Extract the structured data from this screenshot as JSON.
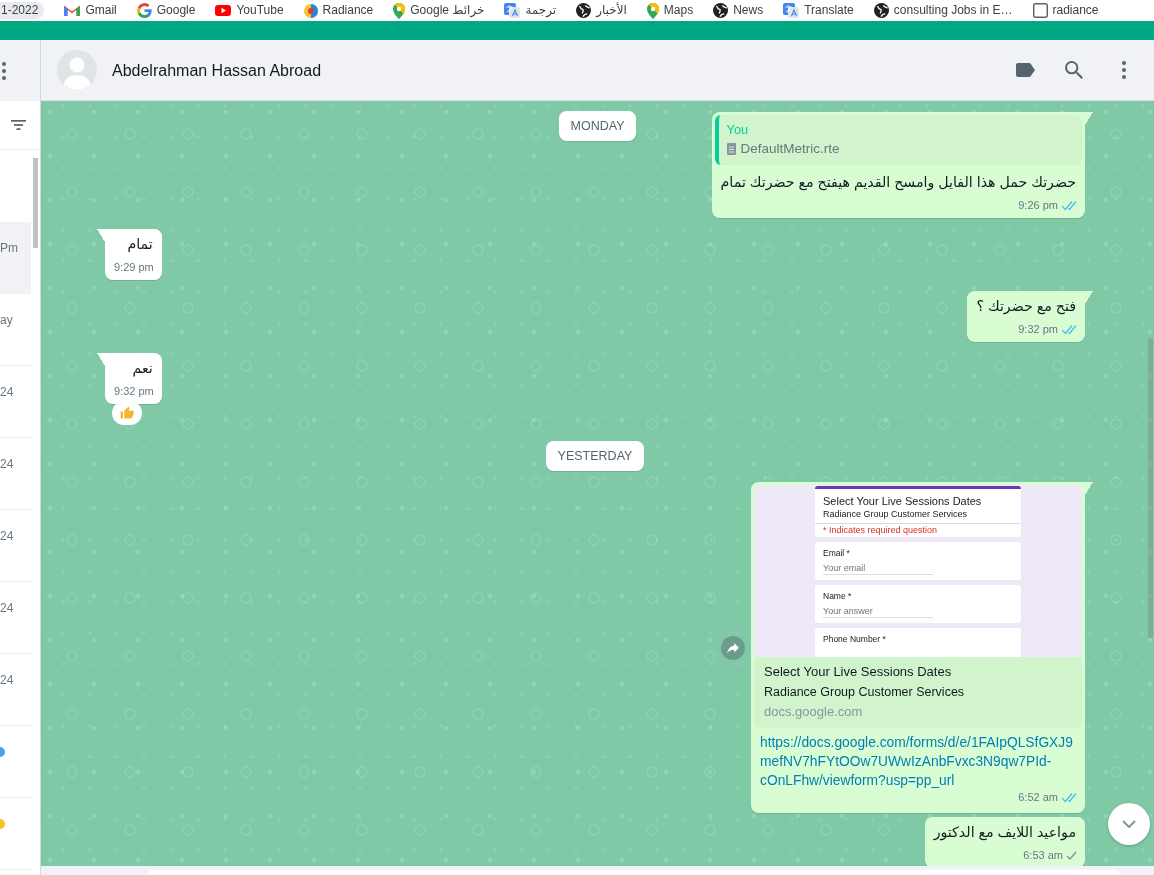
{
  "bookmarks_bar": {
    "items": [
      {
        "label": "1-2022",
        "kind": "chip"
      },
      {
        "label": "Gmail",
        "kind": "mail"
      },
      {
        "label": "Google",
        "kind": "google"
      },
      {
        "label": "YouTube",
        "kind": "video"
      },
      {
        "label": "Radiance",
        "kind": "logo"
      },
      {
        "label": "Google خرائط",
        "kind": "maps"
      },
      {
        "label": "ترجمة",
        "kind": "translate"
      },
      {
        "label": "الأخبار",
        "kind": "globe"
      },
      {
        "label": "Maps",
        "kind": "maps"
      },
      {
        "label": "News",
        "kind": "globe"
      },
      {
        "label": "Translate",
        "kind": "translate"
      },
      {
        "label": "consulting Jobs in E…",
        "kind": "globe"
      },
      {
        "label": "radiance",
        "kind": "page"
      }
    ]
  },
  "sidebar": {
    "rows": [
      {
        "kind": "time",
        "text": "Pm",
        "selected": true
      },
      {
        "kind": "time",
        "text": "ay",
        "selected": false
      },
      {
        "kind": "time",
        "text": "24",
        "selected": false
      },
      {
        "kind": "time",
        "text": "24",
        "selected": false
      },
      {
        "kind": "time",
        "text": "24",
        "selected": false
      },
      {
        "kind": "time",
        "text": "24",
        "selected": false
      },
      {
        "kind": "time",
        "text": "24",
        "selected": false
      },
      {
        "kind": "dot",
        "color": "#3aa8f0",
        "selected": false
      },
      {
        "kind": "dot",
        "color": "#f6c31c",
        "selected": false
      }
    ]
  },
  "chat": {
    "contact": {
      "name": "Abdelrahman Hassan Abroad"
    },
    "messages": [
      {
        "kind": "date",
        "text": "MONDAY",
        "pinned": true
      },
      {
        "kind": "outgoing",
        "tail": true,
        "forward": false,
        "quote": {
          "author": "You",
          "file": "DefaultMetric.rte"
        },
        "text": "حضرتك حمل هذا الفايل وامسح القديم هيفتح مع حضرتك تمام",
        "time": "9:26 pm",
        "read": true
      },
      {
        "kind": "incoming",
        "tail": true,
        "forward": false,
        "text": "تمام",
        "time": "9:29 pm"
      },
      {
        "kind": "outgoing",
        "tail": true,
        "forward": false,
        "text": "فتح مع حضرتك ؟",
        "time": "9:32 pm",
        "read": true
      },
      {
        "kind": "incoming",
        "tail": true,
        "forward": false,
        "text": "نعم",
        "time": "9:32 pm",
        "reaction": true
      },
      {
        "kind": "date",
        "text": "YESTERDAY",
        "pinned": false
      },
      {
        "kind": "outgoing",
        "tail": true,
        "forward": true,
        "preview": {
          "image": {
            "title": "Select Your Live Sessions Dates",
            "subtitle": "Radiance Group Customer Services",
            "note": "* Indicates required question",
            "fields": [
              {
                "label": "Email *",
                "placeholder": "Your email"
              },
              {
                "label": "Name *",
                "placeholder": "Your answer"
              },
              {
                "label": "Phone Number *"
              }
            ]
          },
          "title": "Select Your Live Sessions Dates",
          "description": "Radiance Group Customer Services",
          "domain": "docs.google.com"
        },
        "link": "https://docs.google.com/forms/d/e/1FAIpQLSfGXJ9mefNV7hFYtOOw7UWwIzAnbFvxc3N9qw7PId-cOnLFhw/viewform?usp=pp_url",
        "time": "6:52 am",
        "read": true
      },
      {
        "kind": "outgoing",
        "tail": false,
        "forward": false,
        "text": "مواعيد اللايف مع الدكتور",
        "time": "6:53 am",
        "read": false
      }
    ]
  }
}
